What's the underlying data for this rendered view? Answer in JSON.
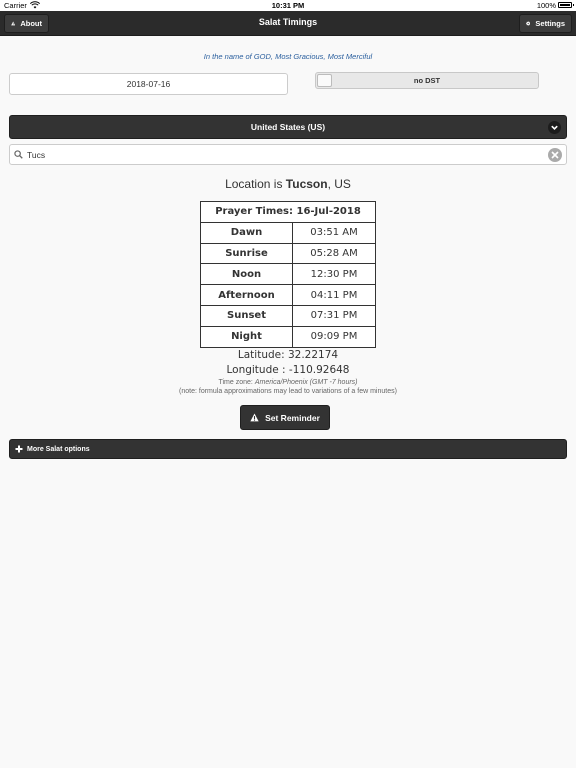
{
  "status_bar": {
    "carrier": "Carrier",
    "time": "10:31 PM",
    "battery": "100%"
  },
  "header": {
    "title": "Salat Timings",
    "about_label": "About",
    "settings_label": "Settings"
  },
  "bismillah": "In the name of GOD, Most Gracious, Most Merciful",
  "date": {
    "value": "2018-07-16"
  },
  "dst": {
    "label": "no DST",
    "enabled": false
  },
  "country": {
    "selected": "United States (US)"
  },
  "search": {
    "value": "Tucs"
  },
  "location": {
    "prefix": "Location is",
    "city": "Tucson",
    "country": ", US"
  },
  "prayer_times": {
    "header": "Prayer Times: 16-Jul-2018",
    "rows": [
      {
        "name": "Dawn",
        "time": "03:51 AM"
      },
      {
        "name": "Sunrise",
        "time": "05:28 AM"
      },
      {
        "name": "Noon",
        "time": "12:30 PM"
      },
      {
        "name": "Afternoon",
        "time": "04:11 PM"
      },
      {
        "name": "Sunset",
        "time": "07:31 PM"
      },
      {
        "name": "Night",
        "time": "09:09 PM"
      }
    ]
  },
  "latitude": "Latitude: 32.22174",
  "longitude": "Longitude : -110.92648",
  "timezone": {
    "prefix": "Time zone:",
    "zone": "America/Phoenix (GMT -7 hours)"
  },
  "note": "(note: formula approximations may lead to variations of a few minutes)",
  "reminder_label": "Set Reminder",
  "more_options_label": "More Salat options",
  "icons": {
    "about": "warning-triangle-icon",
    "settings": "gear-icon",
    "chevron": "chevron-down-icon",
    "search": "search-icon",
    "clear": "clear-icon",
    "reminder": "warning-triangle-icon",
    "more": "plus-icon"
  },
  "colors": {
    "header_bg": "#2b2b2b",
    "button_bg": "#333333",
    "bismillah": "#2a5f9e",
    "page_bg": "#f9f9f9"
  }
}
